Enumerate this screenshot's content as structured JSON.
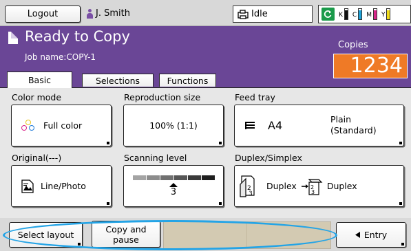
{
  "topbar": {
    "logout_label": "Logout",
    "user_name": "J. Smith",
    "status": "Idle",
    "ink": [
      {
        "letter": "K",
        "color": "#111111",
        "level": 0.85
      },
      {
        "letter": "C",
        "color": "#1ea2d8",
        "level": 0.85
      },
      {
        "letter": "M",
        "color": "#d8268a",
        "level": 0.85
      },
      {
        "letter": "Y",
        "color": "#f0dc1a",
        "level": 0.85
      }
    ]
  },
  "header": {
    "title": "Ready to Copy",
    "job_name": "Job name:COPY-1",
    "copies_label": "Copies",
    "copies_value": "1234",
    "tabs": {
      "basic": "Basic",
      "selections": "Selections",
      "functions": "Functions"
    }
  },
  "settings": {
    "color_mode": {
      "label": "Color mode",
      "value": "Full color"
    },
    "reproduction_size": {
      "label": "Reproduction size",
      "value": "100% (1:1)"
    },
    "feed_tray": {
      "label": "Feed tray",
      "size": "A4",
      "paper": "Plain",
      "paper2": "(Standard)"
    },
    "original": {
      "label": "Original(---)",
      "value": "Line/Photo"
    },
    "scanning_level": {
      "label": "Scanning level",
      "value": "3"
    },
    "duplex_simplex": {
      "label": "Duplex/Simplex",
      "from": "Duplex",
      "to": "Duplex"
    }
  },
  "bottom": {
    "select_layout": "Select layout",
    "copy_pause_1": "Copy and",
    "copy_pause_2": "pause",
    "entry": "Entry"
  },
  "colors": {
    "header_purple": "#6a4696",
    "copies_orange": "#ef7a26",
    "highlight_blue": "#24a4e6"
  }
}
